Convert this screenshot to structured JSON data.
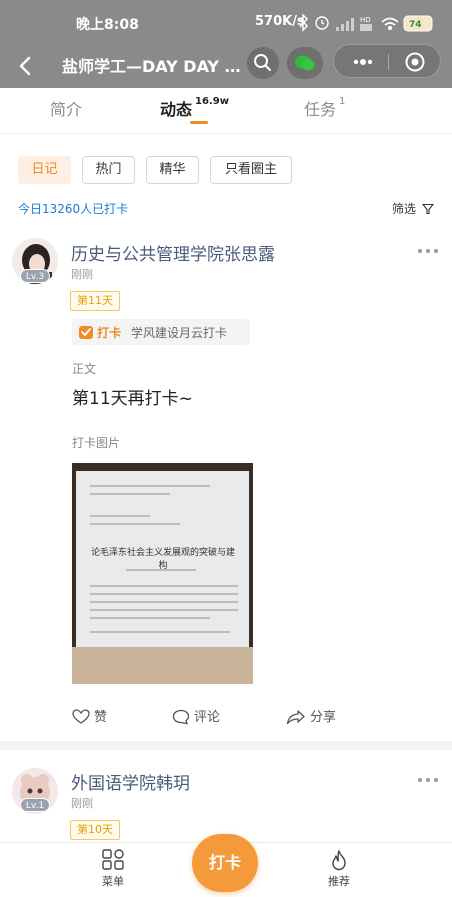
{
  "status_bar": {
    "time": "晚上8:08",
    "net_speed": "570K/s",
    "icons": [
      "bluetooth-icon",
      "alarm-icon",
      "signal-icon",
      "hd-icon",
      "wifi-icon",
      "battery-icon"
    ]
  },
  "nav": {
    "title": "盐师学工—DAY DAY UP",
    "icons": [
      "back-icon",
      "search-icon",
      "wechat-icon",
      "more-icon",
      "close-mini-program-icon"
    ]
  },
  "tabs": [
    {
      "label": "简介",
      "count": ""
    },
    {
      "label": "动态",
      "count": "16.9w"
    },
    {
      "label": "任务",
      "count": "1"
    }
  ],
  "filters": [
    "日记",
    "热门",
    "精华",
    "只看圈主"
  ],
  "checkin_count": "今日13260人已打卡",
  "filter_label": "筛选",
  "colors": {
    "accent": "#f08a24",
    "link": "#1f7ad3",
    "username": "#4a5b7a"
  },
  "posts": [
    {
      "user": "历史与公共管理学院张思露",
      "level": "Lv.3",
      "time": "刚刚",
      "day_badge": "第11天",
      "tag_label": "打卡",
      "tag_name": "学风建设月云打卡",
      "text_label": "正文",
      "text": "第11天再打卡~",
      "image_label": "打卡图片",
      "image_doc_title": "论毛泽东社会主义发展观的突破与建构",
      "actions": {
        "like": "赞",
        "comment": "评论",
        "share": "分享"
      }
    },
    {
      "user": "外国语学院韩玥",
      "level": "Lv.1",
      "time": "刚刚",
      "day_badge": "第10天"
    }
  ],
  "bottom_nav": {
    "menu": "菜单",
    "punch": "打卡",
    "recommend": "推荐"
  }
}
